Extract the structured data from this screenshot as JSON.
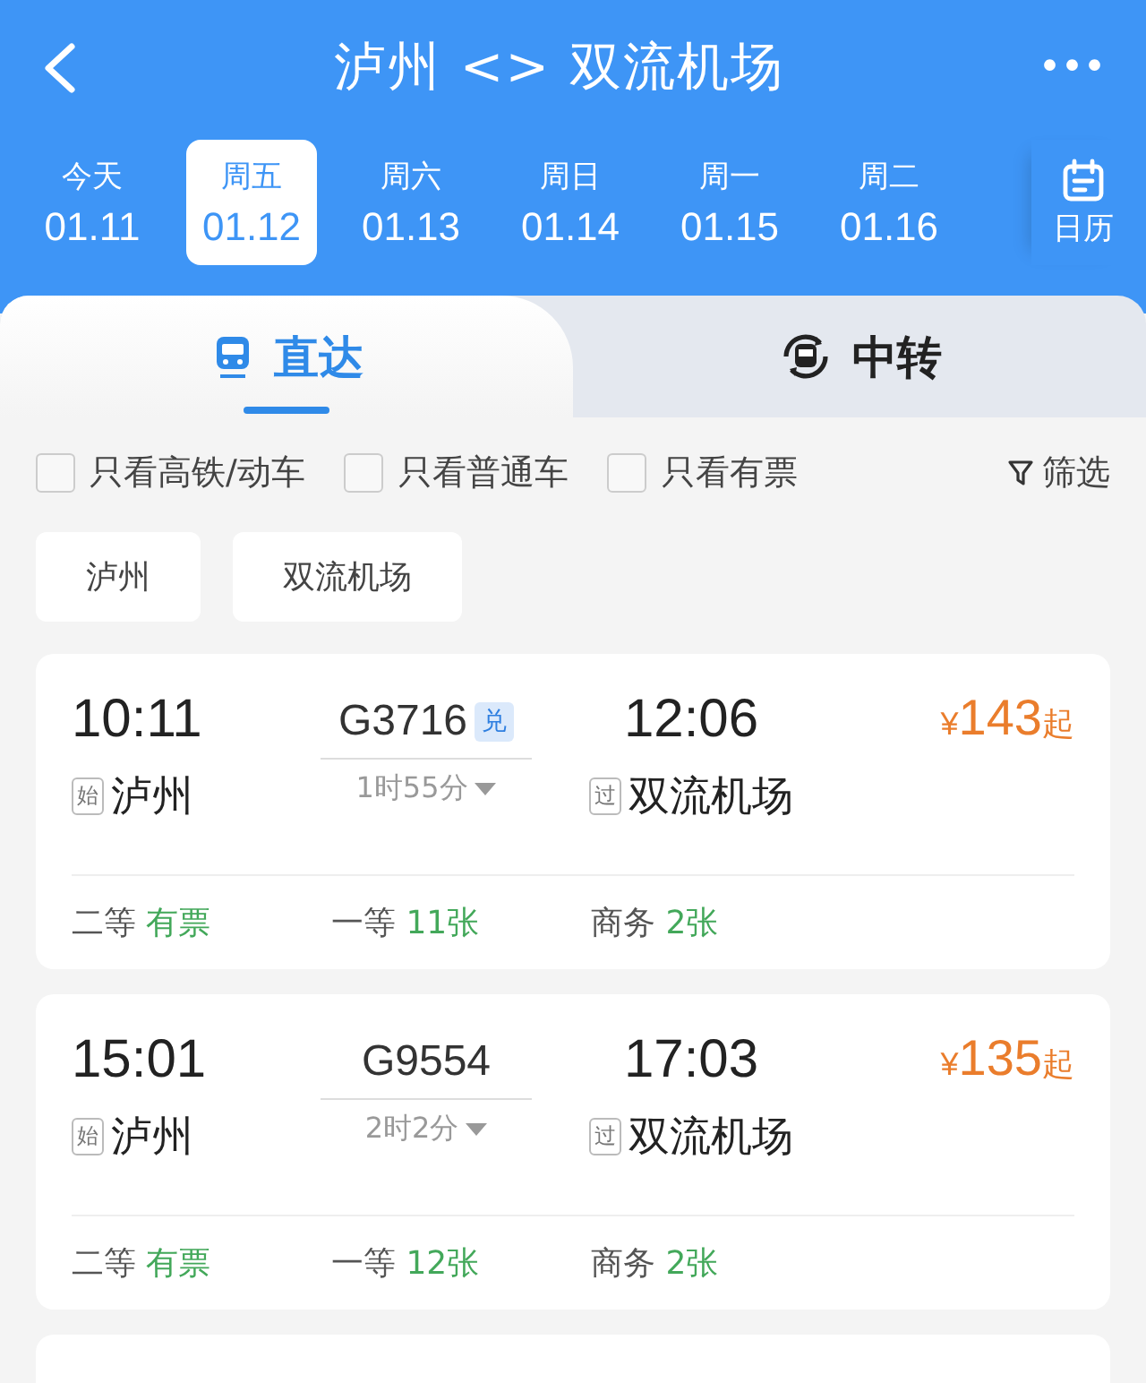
{
  "header": {
    "title": "泸州 <> 双流机场",
    "more": "•••"
  },
  "dates": [
    {
      "weekday": "今天",
      "date": "01.11",
      "selected": false
    },
    {
      "weekday": "周五",
      "date": "01.12",
      "selected": true
    },
    {
      "weekday": "周六",
      "date": "01.13",
      "selected": false
    },
    {
      "weekday": "周日",
      "date": "01.14",
      "selected": false
    },
    {
      "weekday": "周一",
      "date": "01.15",
      "selected": false
    },
    {
      "weekday": "周二",
      "date": "01.16",
      "selected": false
    }
  ],
  "calendar": {
    "label": "日历"
  },
  "tabs": [
    {
      "label": "直达",
      "selected": true
    },
    {
      "label": "中转",
      "selected": false
    }
  ],
  "filters": [
    {
      "label": "只看高铁/动车",
      "checked": false
    },
    {
      "label": "只看普通车",
      "checked": false
    },
    {
      "label": "只看有票",
      "checked": false
    }
  ],
  "filter_button": "筛选",
  "stations": [
    "泸州",
    "双流机场"
  ],
  "trains": [
    {
      "depart": "10:11",
      "from_tag": "始",
      "from": "泸州",
      "number": "G3716",
      "badge": "兑",
      "duration": "1时55分",
      "arrive": "12:06",
      "to_tag": "过",
      "to": "双流机场",
      "price": {
        "currency": "¥",
        "amount": "143",
        "suffix": "起"
      },
      "seats": [
        {
          "class": "二等",
          "availability": "有票"
        },
        {
          "class": "一等",
          "availability": "11张"
        },
        {
          "class": "商务",
          "availability": "2张"
        }
      ]
    },
    {
      "depart": "15:01",
      "from_tag": "始",
      "from": "泸州",
      "number": "G9554",
      "duration": "2时2分",
      "arrive": "17:03",
      "to_tag": "过",
      "to": "双流机场",
      "price": {
        "currency": "¥",
        "amount": "135",
        "suffix": "起"
      },
      "seats": [
        {
          "class": "二等",
          "availability": "有票"
        },
        {
          "class": "一等",
          "availability": "12张"
        },
        {
          "class": "商务",
          "availability": "2张"
        }
      ]
    }
  ]
}
